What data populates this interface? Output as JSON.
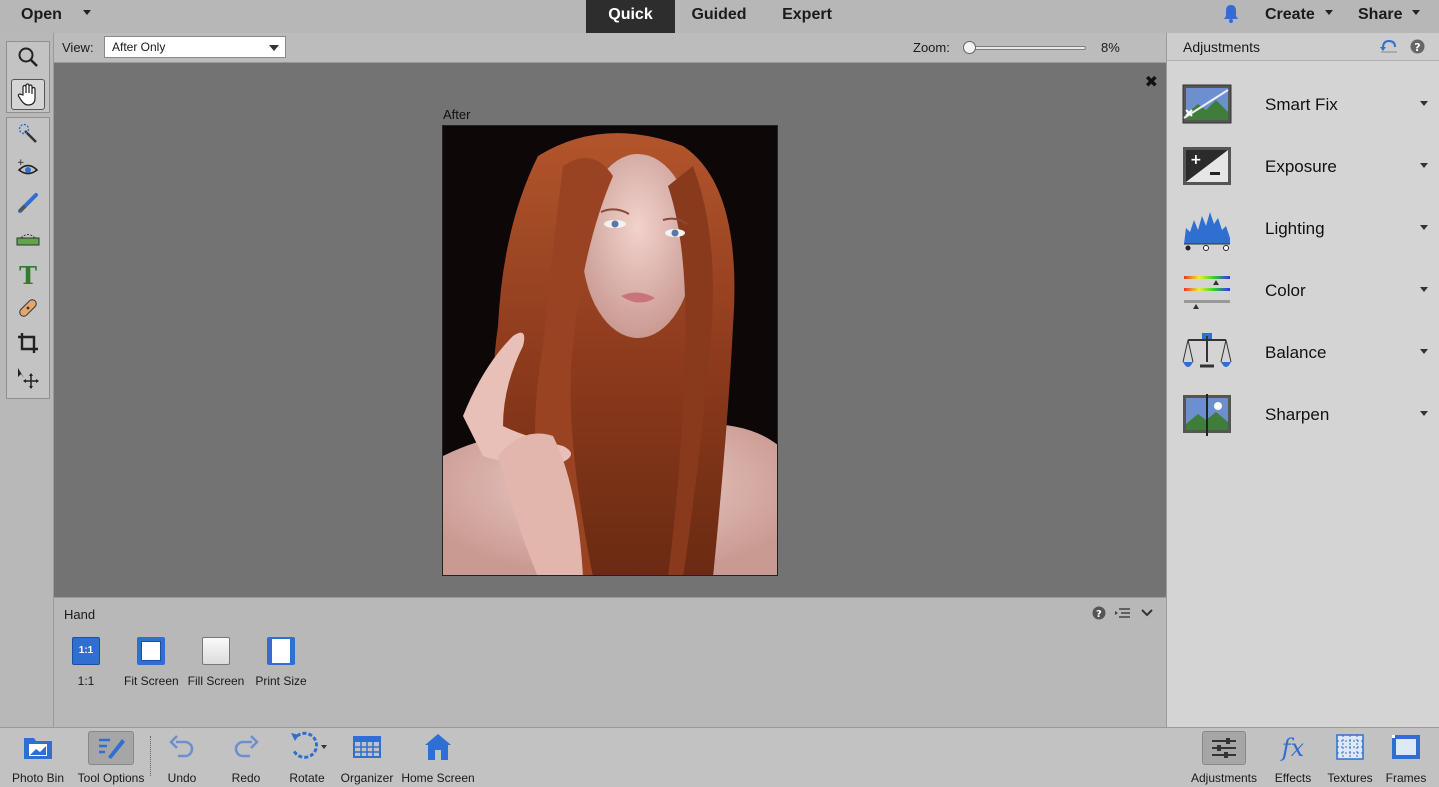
{
  "topbar": {
    "open_label": "Open",
    "tabs": [
      {
        "label": "Quick",
        "active": true
      },
      {
        "label": "Guided",
        "active": false
      },
      {
        "label": "Expert",
        "active": false
      }
    ],
    "notification_icon": "bell-icon",
    "create_label": "Create",
    "share_label": "Share"
  },
  "toolbar": {
    "tools": [
      "zoom-tool",
      "hand-tool",
      "quick-selection-tool",
      "red-eye-tool",
      "whiten-teeth-tool",
      "straighten-tool",
      "type-tool",
      "spot-healing-tool",
      "crop-tool",
      "move-tool"
    ],
    "selected": "hand-tool"
  },
  "options": {
    "view_label": "View:",
    "view_value": "After Only",
    "zoom_label": "Zoom:",
    "zoom_value": "8%",
    "zoom_fraction": 0.0
  },
  "canvas": {
    "photo_caption": "After"
  },
  "tool_options": {
    "tool_name": "Hand",
    "buttons": [
      {
        "label": "1:1",
        "icon_text": "1:1"
      },
      {
        "label": "Fit Screen"
      },
      {
        "label": "Fill Screen"
      },
      {
        "label": "Print Size"
      }
    ]
  },
  "adjustments": {
    "title": "Adjustments",
    "items": [
      {
        "label": "Smart Fix"
      },
      {
        "label": "Exposure"
      },
      {
        "label": "Lighting"
      },
      {
        "label": "Color"
      },
      {
        "label": "Balance"
      },
      {
        "label": "Sharpen"
      }
    ]
  },
  "bottombar": {
    "left": [
      {
        "label": "Photo Bin"
      },
      {
        "label": "Tool Options"
      },
      {
        "label": "Undo"
      },
      {
        "label": "Redo"
      },
      {
        "label": "Rotate"
      },
      {
        "label": "Organizer"
      },
      {
        "label": "Home Screen"
      }
    ],
    "right": [
      {
        "label": "Adjustments"
      },
      {
        "label": "Effects"
      },
      {
        "label": "Textures"
      },
      {
        "label": "Frames"
      }
    ]
  },
  "colors": {
    "accent_blue": "#2f6fd1",
    "active_tab_bg": "#2d2d2d",
    "canvas_bg": "#737373"
  }
}
